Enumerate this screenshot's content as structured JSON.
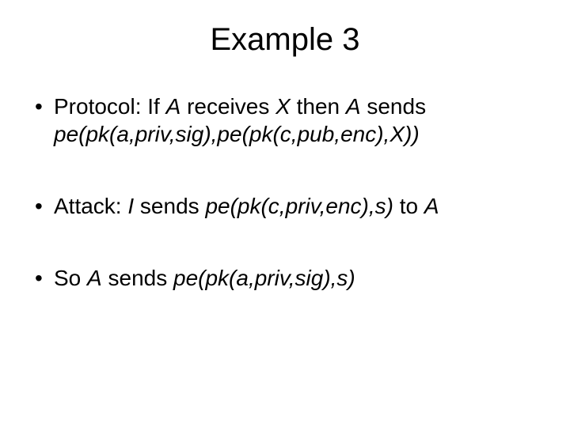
{
  "title": "Example 3",
  "bullets": {
    "b1": {
      "t1": "Protocol: If ",
      "t2": "A",
      "t3": " receives ",
      "t4": "X",
      "t5": " then ",
      "t6": "A",
      "t7": " sends ",
      "t8": "pe(pk(a,priv,sig),pe(pk(c,pub,enc),X))"
    },
    "b2": {
      "t1": "Attack: ",
      "t2": "I",
      "t3": " sends ",
      "t4": "pe(pk(c,priv,enc),s)",
      "t5": " to ",
      "t6": "A"
    },
    "b3": {
      "t1": "So ",
      "t2": "A",
      "t3": " sends ",
      "t4": "pe(pk(a,priv,sig),s)"
    }
  }
}
